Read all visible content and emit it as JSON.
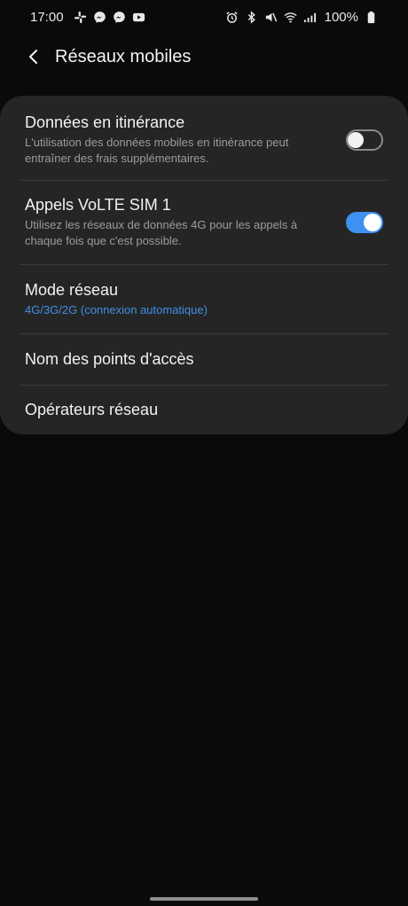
{
  "status_bar": {
    "time": "17:00",
    "left_icons": [
      "slack-icon",
      "messenger-icon",
      "messenger-icon",
      "youtube-icon"
    ],
    "right_icons": [
      "alarm-icon",
      "bluetooth-icon",
      "mute-icon",
      "wifi-icon",
      "signal-icon",
      "battery-icon"
    ],
    "battery": "100%"
  },
  "header": {
    "title": "Réseaux mobiles",
    "back_icon": "chevron-left-icon"
  },
  "settings": {
    "roaming": {
      "title": "Données en itinérance",
      "subtitle": "L'utilisation des données mobiles en itinérance peut entraîner des frais supplémentaires.",
      "enabled": false
    },
    "volte": {
      "title": "Appels VoLTE SIM 1",
      "subtitle": "Utilisez les réseaux de données 4G pour les appels à chaque fois que c'est possible.",
      "enabled": true
    },
    "network_mode": {
      "title": "Mode réseau",
      "value": "4G/3G/2G (connexion automatique)"
    },
    "apn": {
      "title": "Nom des points d'accès"
    },
    "operators": {
      "title": "Opérateurs réseau"
    }
  },
  "colors": {
    "background": "#0a0a0a",
    "card": "#252525",
    "accent": "#3e91f0",
    "subtitle": "#9c9c9c"
  }
}
